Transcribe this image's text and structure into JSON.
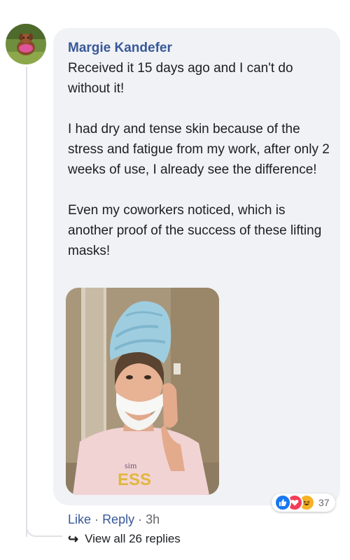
{
  "comment": {
    "author": "Margie Kandefer",
    "paragraphs": [
      "Received it 15 days ago and I can't do without it!",
      "I had dry and tense skin because of the stress and fatigue from my work, after only 2 weeks of use, I already see the difference!",
      "Even my coworkers noticed, which is another proof of the success of these lifting masks!"
    ],
    "photo_text": "sim",
    "photo_text_2": "ESS"
  },
  "reactions": {
    "icons": [
      "like-icon",
      "love-icon",
      "haha-icon"
    ],
    "count": "37"
  },
  "actions": {
    "like": "Like",
    "separator": "·",
    "reply": "Reply",
    "time": "3h"
  },
  "replies": {
    "arrow": "↪",
    "label": "View all 26 replies"
  },
  "colors": {
    "author": "#385898",
    "bubble": "#f0f2f5",
    "like": "#1877f2",
    "love": "#f33e58",
    "haha": "#f7b125"
  }
}
